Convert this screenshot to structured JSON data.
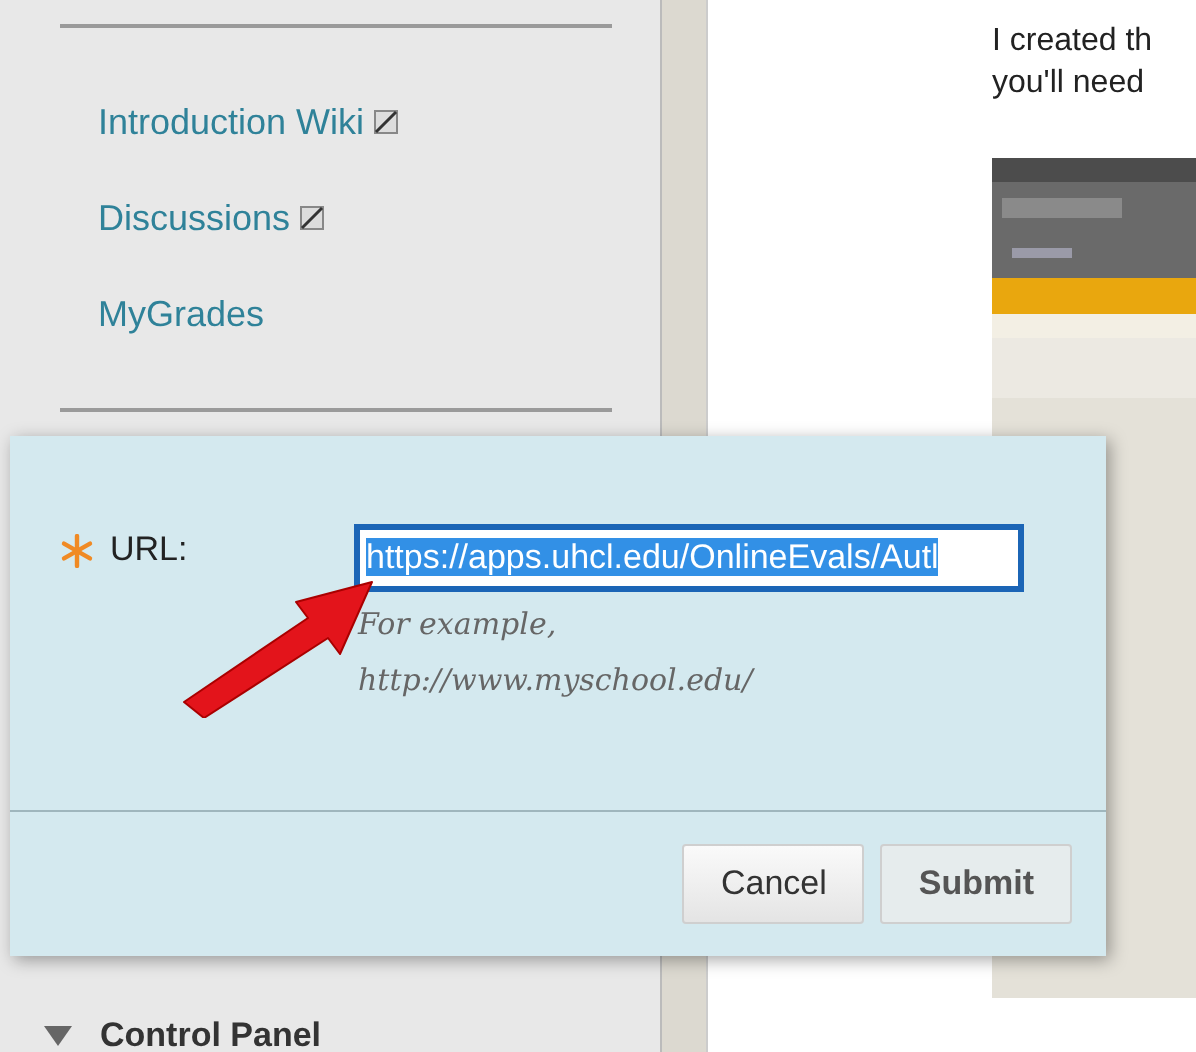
{
  "sidebar": {
    "links": [
      {
        "label": "Introduction Wiki",
        "hidden_marker": true
      },
      {
        "label": "Discussions",
        "hidden_marker": true
      },
      {
        "label": "MyGrades",
        "hidden_marker": false
      }
    ],
    "section": {
      "label": "Control Panel",
      "expanded": true
    }
  },
  "content": {
    "lines": [
      "I created th",
      "you'll need"
    ],
    "thumbnail": {
      "kind": "picture"
    }
  },
  "dialog": {
    "field": {
      "label": "URL:",
      "required": true,
      "value": "https://apps.uhcl.edu/OnlineEvals/Autl",
      "text_selected": true
    },
    "hint": [
      "For example,",
      "http://www.myschool.edu/"
    ],
    "buttons": [
      {
        "label": "Cancel",
        "kind": "secondary"
      },
      {
        "label": "Submit",
        "kind": "primary"
      }
    ]
  }
}
